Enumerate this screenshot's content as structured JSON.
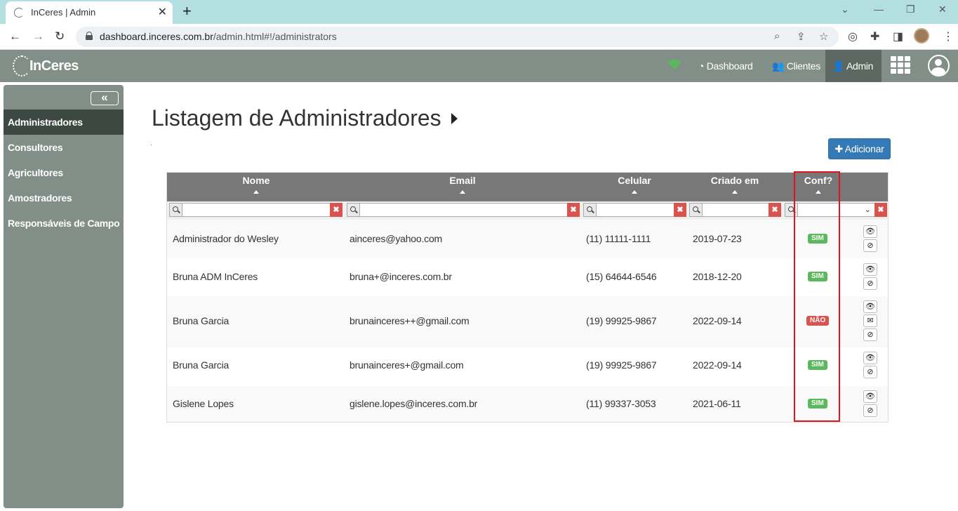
{
  "browser": {
    "tab_title": "InCeres | Admin",
    "tab_close": "✕",
    "new_tab": "+",
    "url_host": "dashboard.inceres.com.br",
    "url_path": "/admin.html#!/administrators"
  },
  "header": {
    "logo": "InCeres",
    "nav": [
      {
        "label": "Dashboard",
        "icon": "dashboard-icon"
      },
      {
        "label": "Clientes",
        "icon": "users-icon"
      },
      {
        "label": "Admin",
        "icon": "user-plus-icon"
      }
    ]
  },
  "sidebar": {
    "collapse_label": "«",
    "items": [
      {
        "label": "Administradores"
      },
      {
        "label": "Consultores"
      },
      {
        "label": "Agricultores"
      },
      {
        "label": "Amostradores"
      },
      {
        "label": "Responsáveis de Campo"
      }
    ]
  },
  "main": {
    "title": "Listagem de Administradores",
    "add_button": "Adicionar",
    "columns": [
      "Nome",
      "Email",
      "Celular",
      "Criado em",
      "Conf?"
    ],
    "rows": [
      {
        "nome": "Administrador do Wesley",
        "email": "ainceres@yahoo.com",
        "celular": "(11) 11111-1111",
        "criado": "2019-07-23",
        "conf": "SIM"
      },
      {
        "nome": "Bruna ADM InCeres",
        "email": "bruna+@inceres.com.br",
        "celular": "(15) 64644-6546",
        "criado": "2018-12-20",
        "conf": "SIM"
      },
      {
        "nome": "Bruna Garcia",
        "email": "brunainceres++@gmail.com",
        "celular": "(19) 99925-9867",
        "criado": "2022-09-14",
        "conf": "NÃO"
      },
      {
        "nome": "Bruna Garcia",
        "email": "brunainceres+@gmail.com",
        "celular": "(19) 99925-9867",
        "criado": "2022-09-14",
        "conf": "SIM"
      },
      {
        "nome": "Gislene Lopes",
        "email": "gislene.lopes@inceres.com.br",
        "celular": "(11) 99337-3053",
        "criado": "2021-06-11",
        "conf": "SIM"
      }
    ]
  },
  "colors": {
    "header_bg": "#828f88",
    "sidebar_active": "#3e4843",
    "primary": "#337ab7",
    "success": "#5cb85c",
    "danger": "#d9534f",
    "highlight": "#e0141e"
  }
}
